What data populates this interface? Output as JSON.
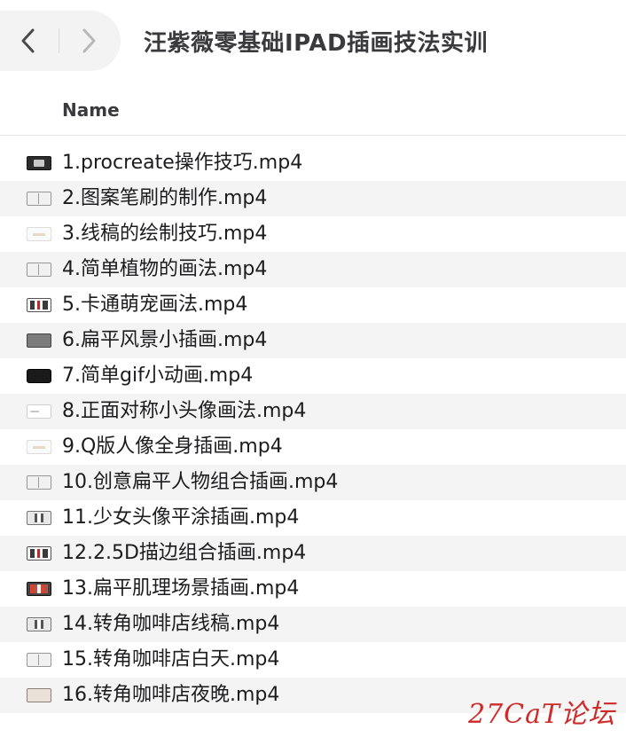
{
  "window": {
    "title": "汪紫薇零基础IPAD插画技法实训"
  },
  "toolbar": {
    "back_icon": "chevron-left-icon",
    "forward_icon": "chevron-right-icon"
  },
  "columns": {
    "name": "Name"
  },
  "files": [
    {
      "name": "1.procreate操作技巧.mp4",
      "thumb": "dark"
    },
    {
      "name": "2.图案笔刷的制作.mp4",
      "thumb": "light"
    },
    {
      "name": "3.线稿的绘制技巧.mp4",
      "thumb": "pale"
    },
    {
      "name": "4.简单植物的画法.mp4",
      "thumb": "light"
    },
    {
      "name": "5.卡通萌宠画法.mp4",
      "thumb": "char"
    },
    {
      "name": "6.扁平风景小插画.mp4",
      "thumb": "gray"
    },
    {
      "name": "7.简单gif小动画.mp4",
      "thumb": "black"
    },
    {
      "name": "8.正面对称小头像画法.mp4",
      "thumb": "white"
    },
    {
      "name": "9.Q版人像全身插画.mp4",
      "thumb": "pale"
    },
    {
      "name": "10.创意扁平人物组合插画.mp4",
      "thumb": "light"
    },
    {
      "name": "11.少女头像平涂插画.mp4",
      "thumb": "mid"
    },
    {
      "name": "12.2.5D描边组合插画.mp4",
      "thumb": "char"
    },
    {
      "name": "13.扁平肌理场景插画.mp4",
      "thumb": "red"
    },
    {
      "name": "14.转角咖啡店线稿.mp4",
      "thumb": "mid"
    },
    {
      "name": "15.转角咖啡店白天.mp4",
      "thumb": "light"
    },
    {
      "name": "16.转角咖啡店夜晚.mp4",
      "thumb": "beige"
    }
  ],
  "watermark": "27CaT论坛",
  "colors": {
    "row_alt": "#f4f4f4",
    "watermark": "#cf2a2a"
  }
}
